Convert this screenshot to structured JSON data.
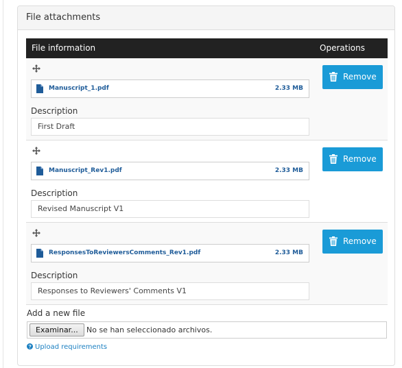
{
  "panel": {
    "title": "File attachments"
  },
  "table": {
    "col_info": "File information",
    "col_ops": "Operations"
  },
  "rows": [
    {
      "file_name": "Manuscript_1.pdf",
      "file_size": "2.33 MB",
      "description_label": "Description",
      "description": "First Draft",
      "remove_label": "Remove"
    },
    {
      "file_name": "Manuscript_Rev1.pdf",
      "file_size": "2.33 MB",
      "description_label": "Description",
      "description": "Revised Manuscript V1",
      "remove_label": "Remove"
    },
    {
      "file_name": "ResponsesToReviewersComments_Rev1.pdf",
      "file_size": "2.33 MB",
      "description_label": "Description",
      "description": "Responses to Reviewers' Comments V1",
      "remove_label": "Remove"
    }
  ],
  "upload": {
    "add_label": "Add a new file",
    "browse_label": "Examinar...",
    "no_file_text": "No se han seleccionado archivos.",
    "requirements_link": "Upload requirements"
  },
  "icons": {
    "move": "move-arrows-icon",
    "document": "document-icon",
    "trash": "trash-icon",
    "help": "question-circle-icon"
  },
  "colors": {
    "header_bg": "#222222",
    "button_bg": "#1a9bd7",
    "link": "#1a7fc1",
    "file_link": "#1f5c99"
  }
}
